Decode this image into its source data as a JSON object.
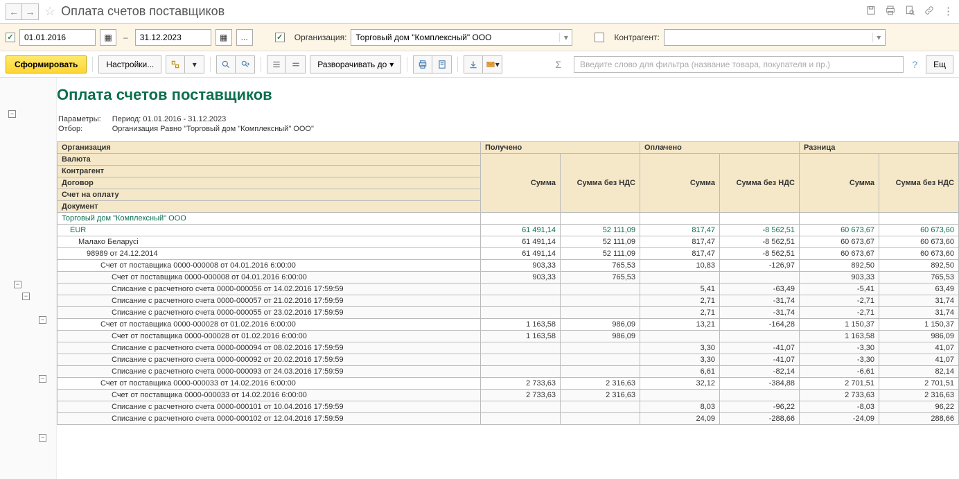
{
  "title": "Оплата счетов поставщиков",
  "title_icons": [
    "save",
    "print",
    "preview",
    "link",
    "more"
  ],
  "filter": {
    "date_from": "01.01.2016",
    "date_to": "31.12.2023",
    "org_label": "Организация:",
    "org_value": "Торговый дом \"Комплексный\" ООО",
    "contr_label": "Контрагент:",
    "dots": "...",
    "dash": "–"
  },
  "toolbar": {
    "generate": "Сформировать",
    "settings": "Настройки...",
    "expand": "Разворачивать до",
    "more": "Ещ",
    "filter_placeholder": "Введите слово для фильтра (название товара, покупателя и пр.)"
  },
  "report": {
    "title": "Оплата счетов поставщиков",
    "params_label": "Параметры:",
    "params_value": "Период: 01.01.2016 - 31.12.2023",
    "filter_label": "Отбор:",
    "filter_value": "Организация Равно \"Торговый дом \"Комплексный\" ООО\""
  },
  "headers": {
    "organization": "Организация",
    "currency": "Валюта",
    "counterparty": "Контрагент",
    "contract": "Договор",
    "account": "Счет на оплату",
    "document": "Документ",
    "received": "Получено",
    "paid": "Оплачено",
    "diff": "Разница",
    "sum": "Сумма",
    "sum_novat": "Сумма без НДС"
  },
  "rows": [
    {
      "type": "org",
      "lvl": 0,
      "gut": 0,
      "label": "Торговый дом \"Комплексный\" ООО",
      "cells": [
        "",
        "",
        "",
        "",
        "",
        ""
      ]
    },
    {
      "type": "cur",
      "lvl": 1,
      "gut": 1,
      "btn": "-",
      "label": "EUR",
      "cells": [
        "61 491,14",
        "52 111,09",
        "817,47",
        "-8 562,51",
        "60 673,67",
        "60 673,60"
      ]
    },
    {
      "type": "cp",
      "lvl": 2,
      "gut": 2,
      "btn": "-",
      "label": "Малако Беларусi",
      "cells": [
        "61 491,14",
        "52 111,09",
        "817,47",
        "-8 562,51",
        "60 673,67",
        "60 673,60"
      ]
    },
    {
      "type": "ct",
      "lvl": 3,
      "gut": 3,
      "label": "98989 от 24.12.2014",
      "cells": [
        "61 491,14",
        "52 111,09",
        "817,47",
        "-8 562,51",
        "60 673,67",
        "60 673,60"
      ]
    },
    {
      "type": "acc",
      "lvl": 4,
      "gut": 4,
      "btn": "-",
      "label": "Счет от поставщика 0000-000008 от 04.01.2016 6:00:00",
      "cells": [
        "903,33",
        "765,53",
        "10,83",
        "-126,97",
        "892,50",
        "892,50"
      ]
    },
    {
      "type": "doc",
      "lvl": 5,
      "gut": 5,
      "label": "Счет от поставщика 0000-000008 от 04.01.2016 6:00:00",
      "cells": [
        "903,33",
        "765,53",
        "",
        "",
        "903,33",
        "765,53"
      ]
    },
    {
      "type": "doc",
      "lvl": 5,
      "gut": 5,
      "label": "Списание с расчетного счета 0000-000056 от 14.02.2016 17:59:59",
      "cells": [
        "",
        "",
        "5,41",
        "-63,49",
        "-5,41",
        "63,49"
      ]
    },
    {
      "type": "doc",
      "lvl": 5,
      "gut": 5,
      "label": "Списание с расчетного счета 0000-000057 от 21.02.2016 17:59:59",
      "cells": [
        "",
        "",
        "2,71",
        "-31,74",
        "-2,71",
        "31,74"
      ]
    },
    {
      "type": "doc",
      "lvl": 5,
      "gut": 5,
      "label": "Списание с расчетного счета 0000-000055 от 23.02.2016 17:59:59",
      "cells": [
        "",
        "",
        "2,71",
        "-31,74",
        "-2,71",
        "31,74"
      ]
    },
    {
      "type": "acc",
      "lvl": 4,
      "gut": 4,
      "btn": "-",
      "label": "Счет от поставщика 0000-000028 от 01.02.2016 6:00:00",
      "cells": [
        "1 163,58",
        "986,09",
        "13,21",
        "-164,28",
        "1 150,37",
        "1 150,37"
      ]
    },
    {
      "type": "doc",
      "lvl": 5,
      "gut": 5,
      "label": "Счет от поставщика 0000-000028 от 01.02.2016 6:00:00",
      "cells": [
        "1 163,58",
        "986,09",
        "",
        "",
        "1 163,58",
        "986,09"
      ]
    },
    {
      "type": "doc",
      "lvl": 5,
      "gut": 5,
      "label": "Списание с расчетного счета 0000-000094 от 08.02.2016 17:59:59",
      "cells": [
        "",
        "",
        "3,30",
        "-41,07",
        "-3,30",
        "41,07"
      ]
    },
    {
      "type": "doc",
      "lvl": 5,
      "gut": 5,
      "label": "Списание с расчетного счета 0000-000092 от 20.02.2016 17:59:59",
      "cells": [
        "",
        "",
        "3,30",
        "-41,07",
        "-3,30",
        "41,07"
      ]
    },
    {
      "type": "doc",
      "lvl": 5,
      "gut": 5,
      "label": "Списание с расчетного счета 0000-000093 от 24.03.2016 17:59:59",
      "cells": [
        "",
        "",
        "6,61",
        "-82,14",
        "-6,61",
        "82,14"
      ]
    },
    {
      "type": "acc",
      "lvl": 4,
      "gut": 4,
      "btn": "-",
      "label": "Счет от поставщика 0000-000033 от 14.02.2016 6:00:00",
      "cells": [
        "2 733,63",
        "2 316,63",
        "32,12",
        "-384,88",
        "2 701,51",
        "2 701,51"
      ]
    },
    {
      "type": "doc",
      "lvl": 5,
      "gut": 5,
      "label": "Счет от поставщика 0000-000033 от 14.02.2016 6:00:00",
      "cells": [
        "2 733,63",
        "2 316,63",
        "",
        "",
        "2 733,63",
        "2 316,63"
      ]
    },
    {
      "type": "doc",
      "lvl": 5,
      "gut": 5,
      "label": "Списание с расчетного счета 0000-000101 от 10.04.2016 17:59:59",
      "cells": [
        "",
        "",
        "8,03",
        "-96,22",
        "-8,03",
        "96,22"
      ]
    },
    {
      "type": "doc",
      "lvl": 5,
      "gut": 5,
      "label": "Списание с расчетного счета 0000-000102 от 12.04.2016 17:59:59",
      "cells": [
        "",
        "",
        "24,09",
        "-288,66",
        "-24,09",
        "288,66"
      ]
    }
  ]
}
